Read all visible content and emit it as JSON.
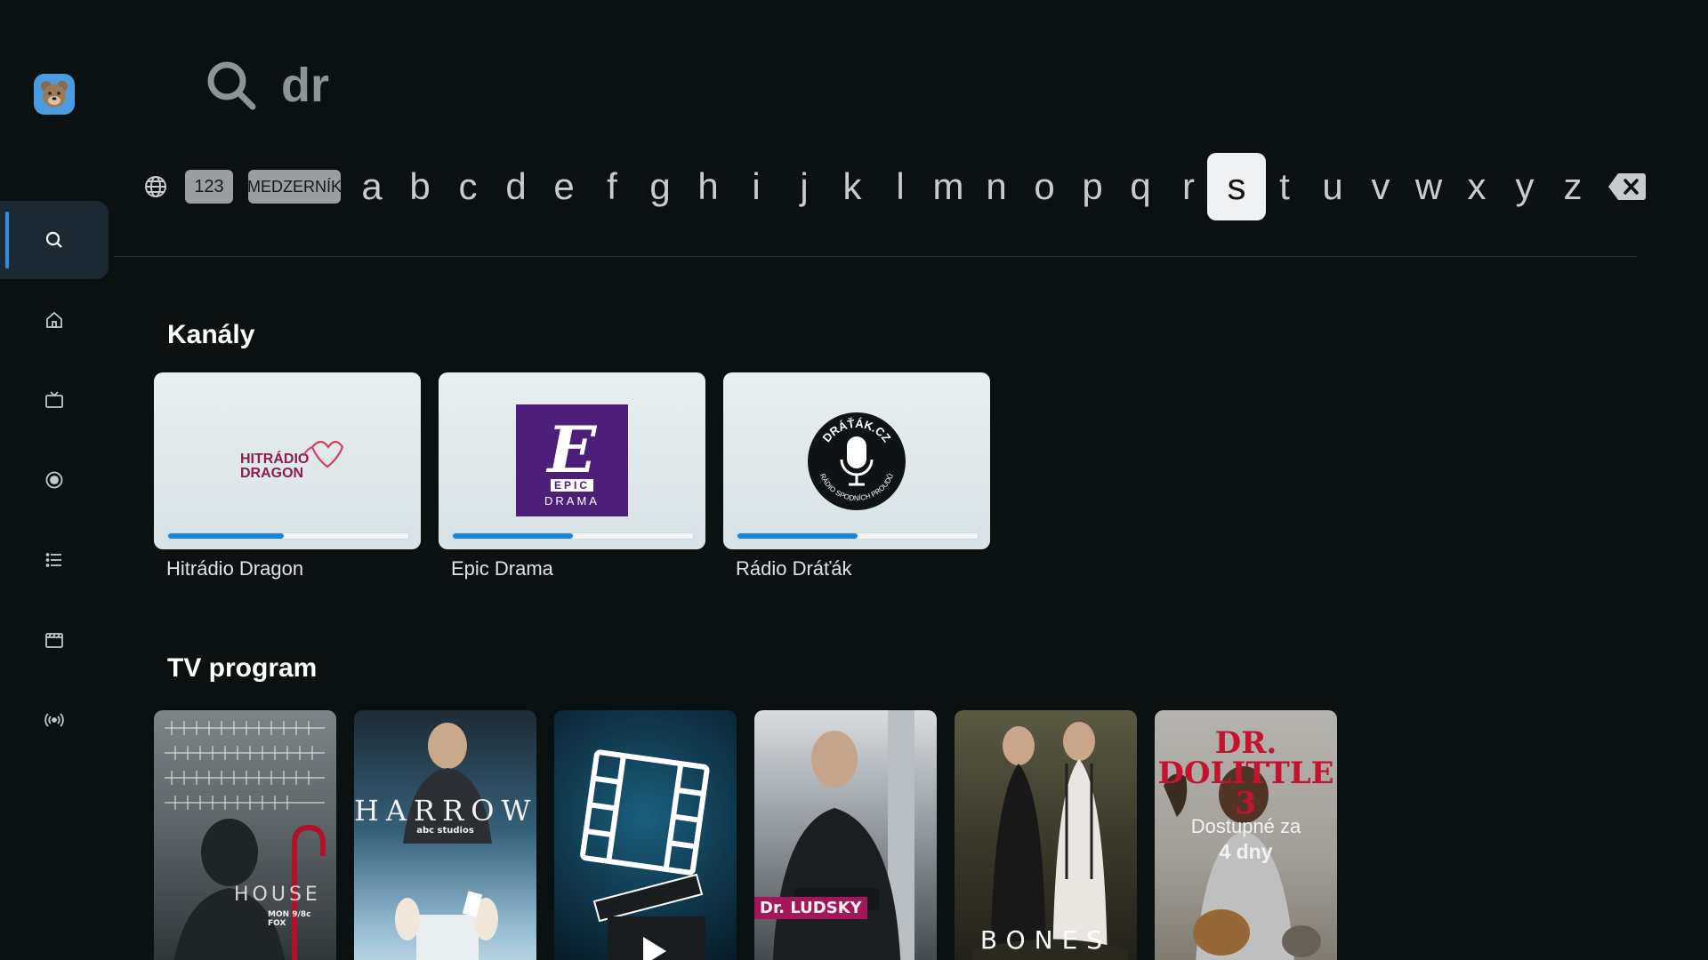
{
  "search": {
    "query": "dr"
  },
  "keyboard": {
    "special_123": "123",
    "space_label": "MEDZERNÍK",
    "letters": [
      "a",
      "b",
      "c",
      "d",
      "e",
      "f",
      "g",
      "h",
      "i",
      "j",
      "k",
      "l",
      "m",
      "n",
      "o",
      "p",
      "q",
      "r",
      "s",
      "t",
      "u",
      "v",
      "w",
      "x",
      "y",
      "z"
    ],
    "selected": "s"
  },
  "sections": {
    "channels_title": "Kanály",
    "tv_program_title": "TV program"
  },
  "channels": [
    {
      "name": "Hitrádio Dragon",
      "progress_percent": 48,
      "logo_text_1": "HITRÁDIO",
      "logo_text_2": "DRAGON"
    },
    {
      "name": "Epic Drama",
      "progress_percent": 50,
      "logo_text_1": "EPIC",
      "logo_text_2": "DRAMA"
    },
    {
      "name": "Rádio Dráťák",
      "progress_percent": 50,
      "logo_text_1": "DRÁŤÁK.CZ",
      "logo_text_2": "RÁDIO SPODNÍCH PROUDŮ"
    }
  ],
  "programs": [
    {
      "title": "HOUSE",
      "subtitle": "MON 9/8c FOX"
    },
    {
      "title": "HARROW",
      "subtitle": "abc studios"
    },
    {
      "title": ""
    },
    {
      "title": "Dr. LUDSKY"
    },
    {
      "title": "BONES"
    },
    {
      "title": "DR. DOLITTLE 3",
      "availability_line1": "Dostupné za",
      "availability_line2": "4 dny"
    }
  ],
  "colors": {
    "accent": "#2f8fe0",
    "progress": "#1f84cf",
    "background": "#0b1011"
  }
}
